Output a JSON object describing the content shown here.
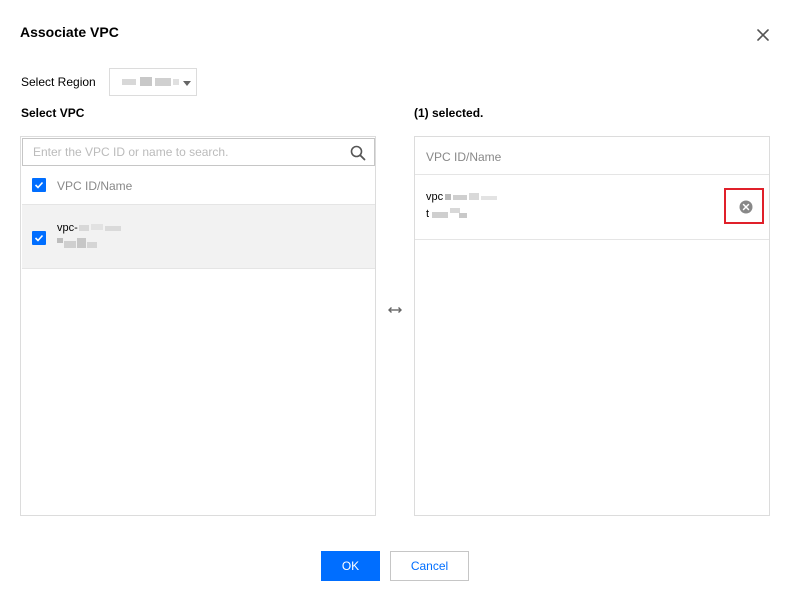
{
  "dialog": {
    "title": "Associate VPC",
    "close_icon": "close-icon"
  },
  "region": {
    "label": "Select Region",
    "selected_value": "",
    "dropdown_icon": "caret-down-icon"
  },
  "left_panel": {
    "label": "Select VPC",
    "search": {
      "placeholder": "Enter the VPC ID or name to search.",
      "value": "",
      "icon": "search-icon"
    },
    "header": {
      "checked": true,
      "column_label": "VPC ID/Name"
    },
    "rows": [
      {
        "checked": true,
        "id_prefix": "vpc-",
        "name": ""
      }
    ]
  },
  "transfer_icon": "double-arrow-icon",
  "right_panel": {
    "selected_label": "(1) selected.",
    "column_label": "VPC ID/Name",
    "rows": [
      {
        "id_prefix": "vpc",
        "name_prefix": "t",
        "remove_icon": "remove-circle-icon"
      }
    ]
  },
  "footer": {
    "ok_label": "OK",
    "cancel_label": "Cancel"
  },
  "colors": {
    "primary": "#006eff",
    "highlight": "#e0202a",
    "border": "#dcdcdc",
    "selected_row_bg": "#f2f2f2"
  }
}
